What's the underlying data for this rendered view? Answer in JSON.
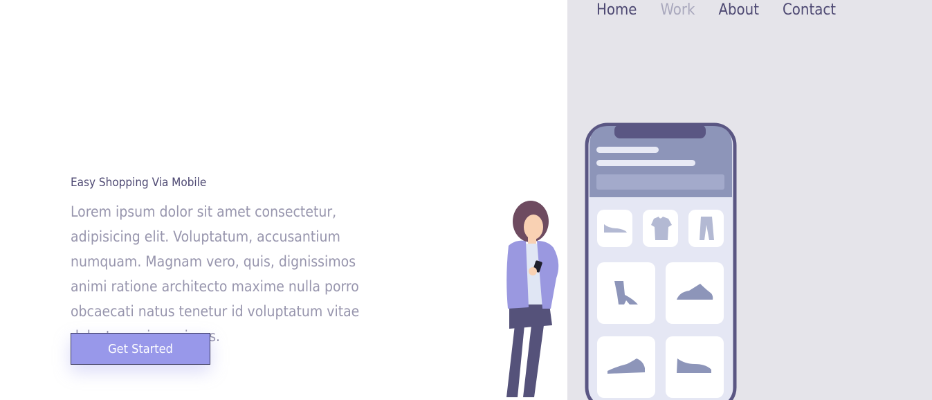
{
  "nav": {
    "items": [
      {
        "label": "Home",
        "active": false
      },
      {
        "label": "Work",
        "active": true
      },
      {
        "label": "About",
        "active": false
      },
      {
        "label": "Contact",
        "active": false
      }
    ]
  },
  "hero": {
    "subtitle": "Easy Shopping Via Mobile",
    "description": "Lorem ipsum dolor sit amet consectetur, adipisicing elit. Voluptatum, accusantium numquam. Magnam vero, quis, dignissimos animi ratione architecto maxime nulla porro obcaecati natus tenetur id voluptatum vitae delectus qui possimus.",
    "cta_label": "Get Started"
  },
  "colors": {
    "accent": "#9898ea",
    "dark": "#4d4872",
    "panel": "#e5e4ea",
    "muted": "#9795ad"
  },
  "illustration": {
    "phone_items": [
      "flat-shoe-icon",
      "tshirt-icon",
      "pants-icon",
      "boot-icon",
      "sneaker-icon",
      "shoe-icon",
      "shoe-icon"
    ]
  }
}
